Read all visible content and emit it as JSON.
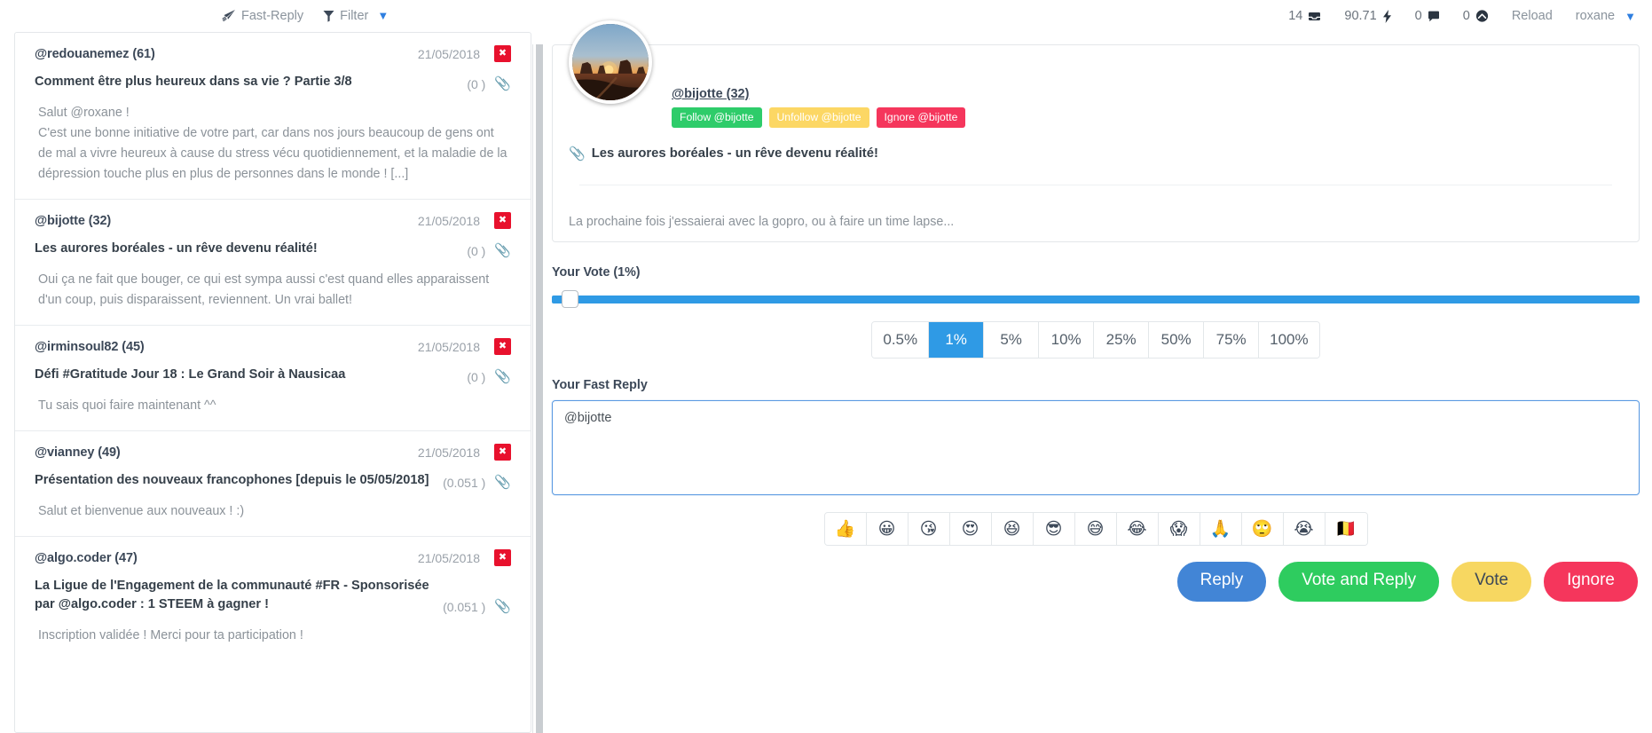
{
  "topbar": {
    "brand": "Fast-Reply",
    "brand_icon": "paper-plane-icon",
    "filter_label": "Filter",
    "filter_icon": "funnel-icon",
    "caret_icon": "chevron-down-icon",
    "stats": [
      {
        "value": "14",
        "icon": "inbox-icon"
      },
      {
        "value": "90.71",
        "icon": "lightning-bolt-icon"
      },
      {
        "value": "0",
        "icon": "comment-icon"
      },
      {
        "value": "0",
        "icon": "steem-cloud-icon"
      }
    ],
    "reload_label": "Reload",
    "user_name": "roxane"
  },
  "post_list": [
    {
      "author": "@redouanemez (61)",
      "date": "21/05/2018",
      "close_icon": "close-x-icon",
      "title": "Comment être plus heureux dans sa vie ? Partie 3/8",
      "payout": "(0 )",
      "link_icon": "paperclip-icon",
      "excerpt": "Salut @roxane !\nC'est une bonne initiative de votre part, car dans nos jours beaucoup de gens ont de mal a vivre heureux à cause du stress vécu quotidiennement, et la maladie de la dépression touche plus en plus de personnes dans le monde ! [...]"
    },
    {
      "author": "@bijotte (32)",
      "date": "21/05/2018",
      "close_icon": "close-x-icon",
      "title": "Les aurores boréales - un rêve devenu réalité!",
      "payout": "(0 )",
      "link_icon": "paperclip-icon",
      "excerpt": "Oui ça ne fait que bouger, ce qui est sympa aussi c'est quand elles apparaissent d'un coup, puis disparaissent, reviennent. Un vrai ballet!"
    },
    {
      "author": "@irminsoul82 (45)",
      "date": "21/05/2018",
      "close_icon": "close-x-icon",
      "title": "Défi #Gratitude Jour 18 : Le Grand Soir à Nausicaa",
      "payout": "(0 )",
      "link_icon": "paperclip-icon",
      "excerpt": "Tu sais quoi faire maintenant ^^"
    },
    {
      "author": "@vianney (49)",
      "date": "21/05/2018",
      "close_icon": "close-x-icon",
      "title": "Présentation des nouveaux francophones [depuis le 05/05/2018]",
      "payout": "(0.051 )",
      "link_icon": "paperclip-icon",
      "excerpt": "Salut et bienvenue aux nouveaux ! :)"
    },
    {
      "author": "@algo.coder (47)",
      "date": "21/05/2018",
      "close_icon": "close-x-icon",
      "title": "La Ligue de l'Engagement de la communauté #FR - Sponsorisée par @algo.coder : 1 STEEM à gagner !",
      "payout": "(0.051 )",
      "link_icon": "paperclip-icon",
      "excerpt": "Inscription validée ! Merci pour ta participation !"
    }
  ],
  "detail": {
    "avatar_icon": "avatar-sunset-landscape",
    "author": "@bijotte (32)",
    "follow_label": "Follow @bijotte",
    "unfollow_label": "Unfollow @bijotte",
    "ignore_label": "Ignore @bijotte",
    "title_icon": "paperclip-icon",
    "title": "Les aurores boréales - un rêve devenu réalité!",
    "body": "La prochaine fois j'essaierai avec la gopro, ou à faire un time lapse..."
  },
  "vote": {
    "label": "Your Vote (1%)",
    "slider_percent": 1,
    "presets": [
      "0.5%",
      "1%",
      "5%",
      "10%",
      "25%",
      "50%",
      "75%",
      "100%"
    ],
    "active_preset": "1%"
  },
  "reply": {
    "label": "Your Fast Reply",
    "value": "@bijotte",
    "placeholder": ""
  },
  "emojis": [
    {
      "glyph": "👍",
      "name": "thumbs-up"
    },
    {
      "glyph": "😀",
      "name": "grinning-face"
    },
    {
      "glyph": "😘",
      "name": "kissing-heart-face"
    },
    {
      "glyph": "😍",
      "name": "heart-eyes-face"
    },
    {
      "glyph": "😆",
      "name": "squinting-laugh-face"
    },
    {
      "glyph": "😎",
      "name": "sunglasses-face"
    },
    {
      "glyph": "😅",
      "name": "sweat-smile-face"
    },
    {
      "glyph": "😂",
      "name": "tears-of-joy-face"
    },
    {
      "glyph": "😱",
      "name": "screaming-face"
    },
    {
      "glyph": "🙏",
      "name": "folded-hands"
    },
    {
      "glyph": "🙄",
      "name": "rolling-eyes-face"
    },
    {
      "glyph": "😭",
      "name": "loudly-crying-face"
    },
    {
      "glyph": "🇧🇪",
      "name": "belgium-flag"
    }
  ],
  "actions": {
    "reply": "Reply",
    "vote_and_reply": "Vote and Reply",
    "vote": "Vote",
    "ignore": "Ignore"
  },
  "colors": {
    "accent_blue": "#2f9ae5",
    "green": "#2ecc5f",
    "yellow": "#f7d761",
    "red": "#f5365c",
    "reply_blue": "#4285d6",
    "close_red": "#e8112d"
  }
}
